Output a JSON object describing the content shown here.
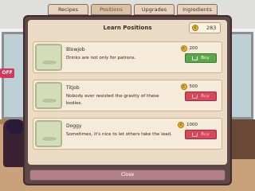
{
  "tabs": [
    {
      "label": "Recipes"
    },
    {
      "label": "Positions",
      "active": true
    },
    {
      "label": "Upgrades"
    },
    {
      "label": "Ingredients"
    }
  ],
  "background": {
    "sign_text": "OFF"
  },
  "dialog": {
    "title": "Learn Positions",
    "money": "283",
    "close_label": "Close"
  },
  "items": [
    {
      "name": "Blowjob",
      "desc": "Drinks are not only for patrons.",
      "price": "200",
      "buy_label": "Buy",
      "affordable": true
    },
    {
      "name": "Titjob",
      "desc": "Nobody ever resisted the gravity of these bodies.",
      "price": "500",
      "buy_label": "Buy",
      "affordable": false
    },
    {
      "name": "Doggy",
      "desc": "Sometimes, it's nice to let others take the lead.",
      "price": "1000",
      "buy_label": "Buy",
      "affordable": false
    }
  ],
  "colors": {
    "buy_enabled": "#5aa84a",
    "buy_disabled": "#d9475a",
    "panel": "#5e4747",
    "panel_inner": "#ecdbc4"
  },
  "icons": {
    "coin": "coin-icon",
    "cart": "cart-icon"
  }
}
